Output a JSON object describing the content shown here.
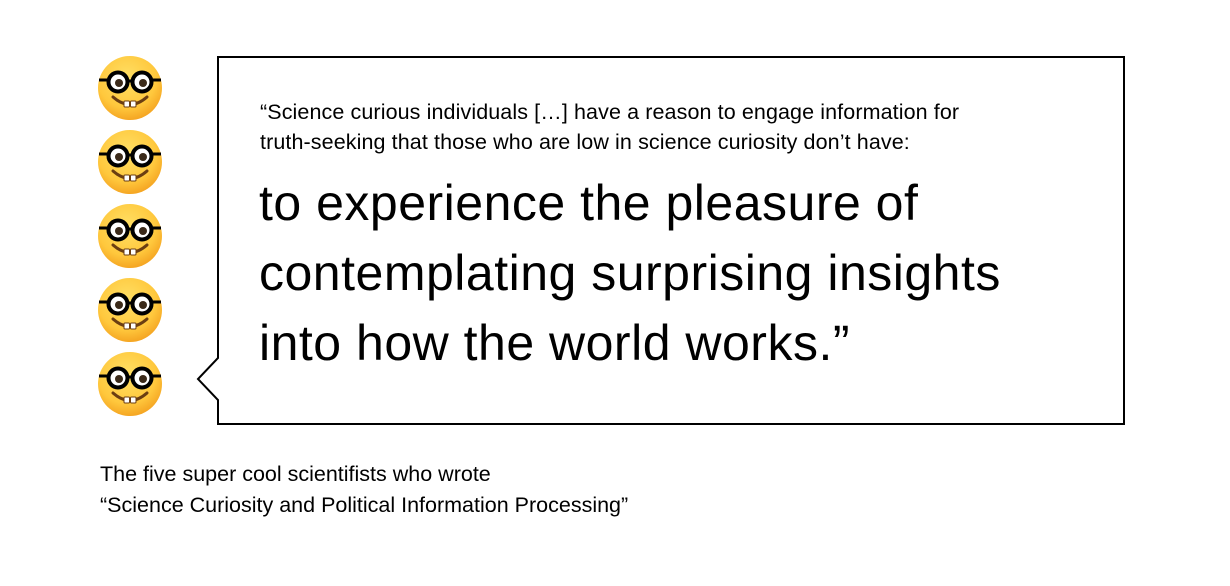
{
  "emojis": [
    {
      "icon": "nerd-face-icon"
    },
    {
      "icon": "nerd-face-icon"
    },
    {
      "icon": "nerd-face-icon"
    },
    {
      "icon": "nerd-face-icon"
    },
    {
      "icon": "nerd-face-icon"
    }
  ],
  "quote": {
    "intro_lines": [
      "“Science curious individuals […] have a reason to engage information for",
      " truth-seeking that those who are low in science curiosity don’t have:"
    ],
    "main_lines": [
      "to experience the pleasure of",
      "contemplating surprising insights",
      "into how the world works.”"
    ]
  },
  "caption": {
    "lines": [
      "The five super cool scientifists who wrote",
      "“Science Curiosity and Political Information Processing”"
    ]
  },
  "colors": {
    "emoji_face": "#FFC83D",
    "emoji_shade": "#F5A623",
    "glasses": "#000000",
    "bubble_border": "#000000",
    "text": "#000000",
    "background": "#FFFFFF"
  }
}
